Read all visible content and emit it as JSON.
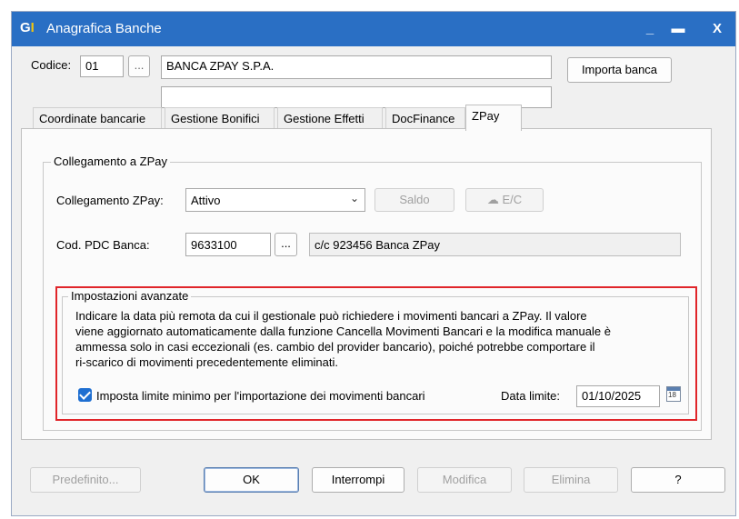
{
  "window": {
    "logo_g": "G",
    "logo_i": "I",
    "title": "Anagrafica Banche",
    "minimize": "_",
    "maximize": "▬",
    "close": "X"
  },
  "header": {
    "codice_label": "Codice:",
    "codice_value": "01",
    "codice_lookup": "...",
    "bank_name": "BANCA ZPAY S.P.A.",
    "bank_name2": "",
    "import_button": "Importa banca"
  },
  "tabs": [
    {
      "label": "Coordinate bancarie"
    },
    {
      "label": "Gestione Bonifici"
    },
    {
      "label": "Gestione Effetti"
    },
    {
      "label": "DocFinance"
    },
    {
      "label": "ZPay"
    }
  ],
  "zpay": {
    "group_title": "Collegamento a ZPay",
    "collegamento_label": "Collegamento ZPay:",
    "collegamento_value": "Attivo",
    "saldo_button": "Saldo",
    "ec_button": "E/C",
    "pdc_label": "Cod. PDC Banca:",
    "pdc_value": "9633100",
    "pdc_lookup": "...",
    "pdc_description": "c/c 923456 Banca ZPay"
  },
  "advanced": {
    "group_title": "Impostazioni avanzate",
    "description_lines": [
      "Indicare la data più remota da cui il gestionale può richiedere i movimenti bancari a ZPay. Il valore",
      "viene aggiornato automaticamente dalla funzione Cancella Movimenti Bancari e la modifica manuale è",
      "ammessa solo in casi eccezionali (es. cambio del provider bancario), poiché potrebbe comportare il",
      "ri-scarico di movimenti precedentemente eliminati."
    ],
    "checkbox_label": "Imposta limite minimo per l'importazione dei movimenti bancari",
    "checkbox_checked": true,
    "date_label": "Data limite:",
    "date_value": "01/10/2025",
    "calendar_day": "18"
  },
  "footer": {
    "predefinito": "Predefinito...",
    "ok": "OK",
    "interrompi": "Interrompi",
    "modifica": "Modifica",
    "elimina": "Elimina",
    "help": "?"
  },
  "colors": {
    "titlebar": "#2a6fc4",
    "highlight_border": "#e0252a",
    "checkbox": "#1f6fd1"
  }
}
